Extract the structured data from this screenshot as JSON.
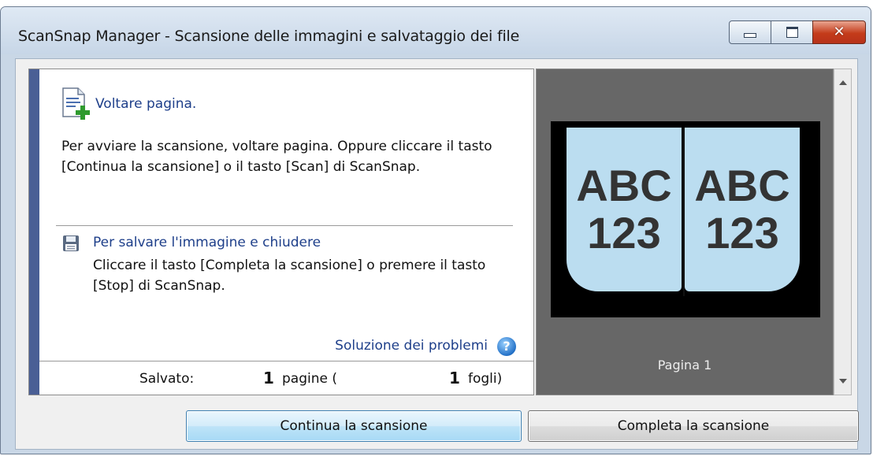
{
  "window": {
    "title": "ScanSnap Manager - Scansione delle immagini e salvataggio dei file",
    "controls": {
      "minimize": "minimize-icon",
      "maximize": "maximize-icon",
      "close": "close-icon"
    }
  },
  "info": {
    "heading": "Voltare pagina.",
    "text": "Per avviare la scansione, voltare pagina. Oppure cliccare il tasto [Continua la scansione] o il tasto [Scan] di ScanSnap.",
    "save_heading": "Per salvare l'immagine e chiudere",
    "save_text": "Cliccare il tasto [Completa la scansione] o premere il tasto [Stop] di ScanSnap.",
    "help_link": "Soluzione dei problemi",
    "help_icon": "?"
  },
  "status": {
    "saved_label": "Salvato:",
    "pages_count": "1",
    "pages_label": "pagine (",
    "sheets_count": "1",
    "sheets_label": "fogli)"
  },
  "preview": {
    "left_page_text": [
      "ABC",
      "123"
    ],
    "right_page_text": [
      "ABC",
      "123"
    ],
    "caption": "Pagina 1"
  },
  "buttons": {
    "continue": "Continua la scansione",
    "complete": "Completa la scansione"
  },
  "colors": {
    "accent": "#4a5f95",
    "link": "#1e3f8a",
    "page_fill": "#bbddf0",
    "preview_bg": "#676767"
  }
}
